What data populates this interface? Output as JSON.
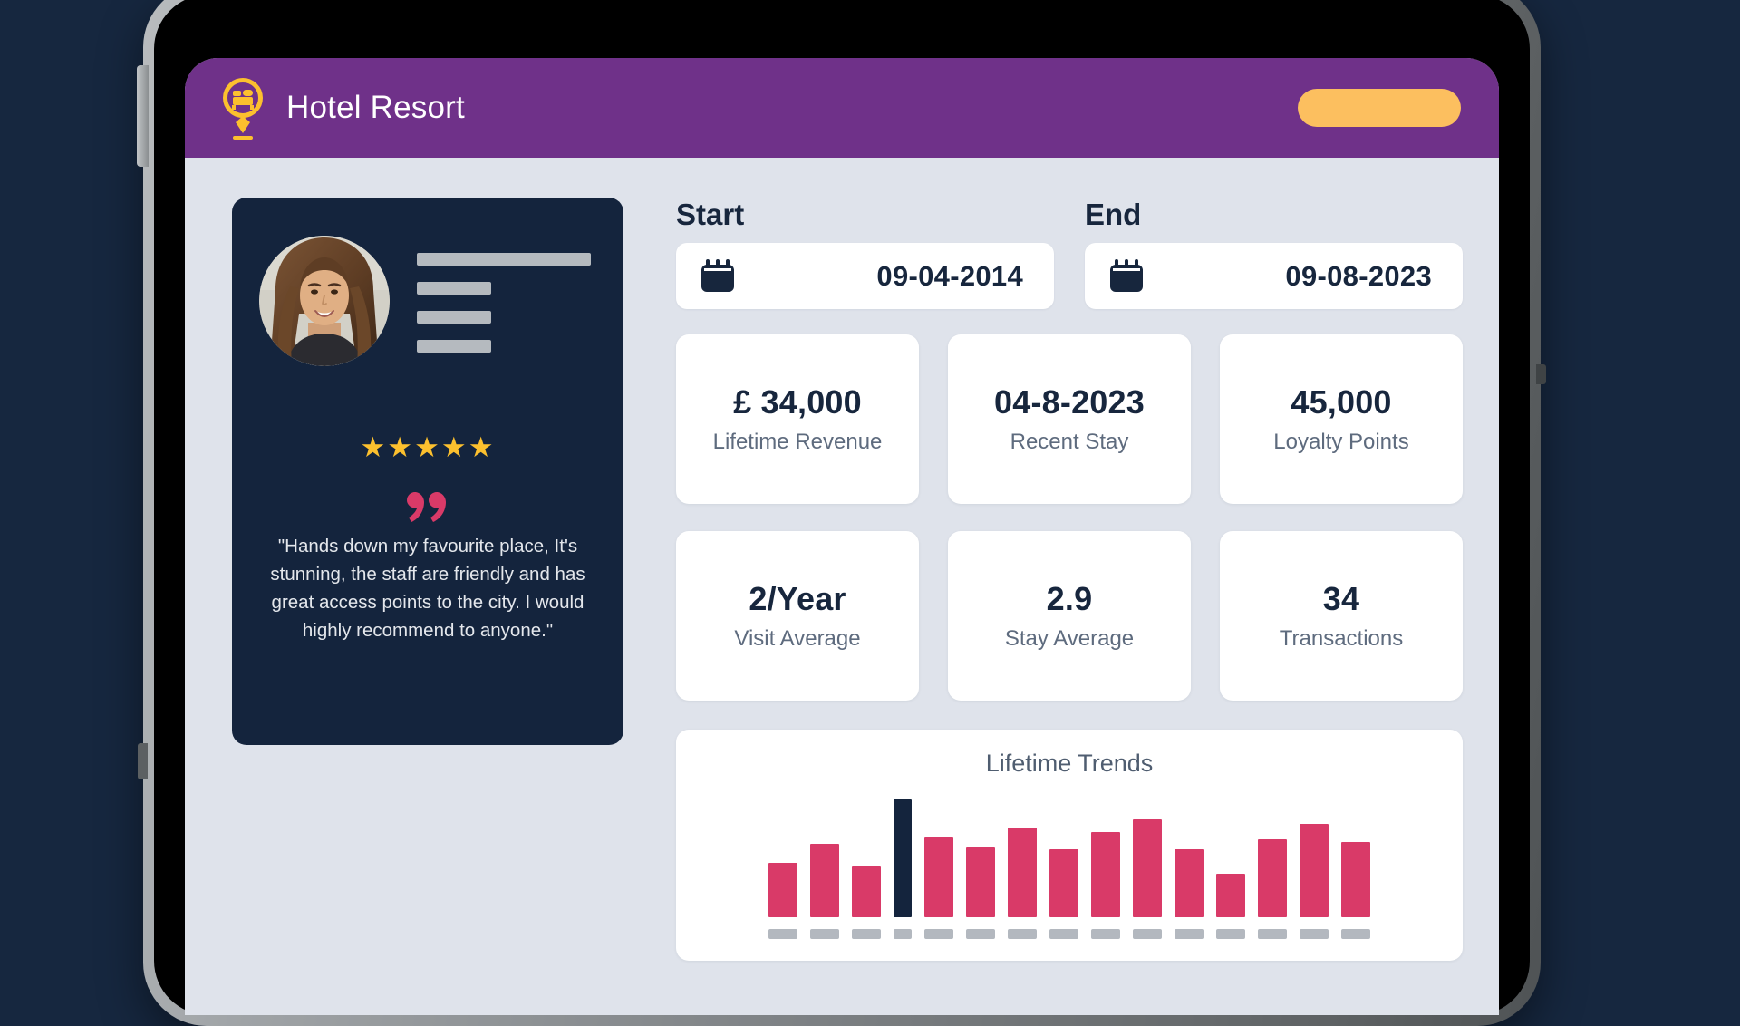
{
  "header": {
    "app_title": "Hotel Resort",
    "logo_icon": "location-pin-bed-icon",
    "action_button_label": "",
    "background_color": "#6f3189",
    "button_color": "#fcbf5f"
  },
  "profile": {
    "avatar_icon": "user-avatar-photo",
    "skeleton_lines": 4,
    "rating": {
      "stars_filled": 5,
      "star_glyph": "★",
      "star_color": "#fcc02e"
    },
    "quote_icon": "quotation-mark-icon",
    "quote_color": "#d93a68",
    "testimonial": "\"Hands down my favourite place, It's stunning, the staff are friendly and has great access points to the city. I would highly recommend to anyone.\"",
    "card_color": "#14243d"
  },
  "date_range": {
    "start": {
      "label": "Start",
      "value": "09-04-2014",
      "icon": "calendar-icon"
    },
    "end": {
      "label": "End",
      "value": "09-08-2023",
      "icon": "calendar-icon"
    }
  },
  "stats": [
    {
      "value": "£ 34,000",
      "label": "Lifetime Revenue"
    },
    {
      "value": "04-8-2023",
      "label": "Recent Stay"
    },
    {
      "value": "45,000",
      "label": "Loyalty Points"
    },
    {
      "value": "2/Year",
      "label": "Visit Average"
    },
    {
      "value": "2.9",
      "label": "Stay Average"
    },
    {
      "value": "34",
      "label": "Transactions"
    }
  ],
  "chart_data": {
    "type": "bar",
    "title": "Lifetime Trends",
    "xlabel": "",
    "ylabel": "",
    "grid": false,
    "legend": null,
    "ylim": [
      0,
      100
    ],
    "bar_color": "#d93a68",
    "highlight_color": "#14243d",
    "highlight_index": 3,
    "categories": [
      "",
      "",
      "",
      "",
      "",
      "",
      "",
      "",
      "",
      "",
      "",
      "",
      "",
      "",
      ""
    ],
    "values": [
      46,
      62,
      43,
      100,
      68,
      59,
      76,
      58,
      72,
      83,
      58,
      37,
      66,
      79,
      64
    ],
    "tick_placeholders": 15
  },
  "device": {
    "frame_color": "#8e9295",
    "bezel_color": "#000000",
    "screen_background": "#dfe3eb",
    "page_background": "#16273f"
  }
}
